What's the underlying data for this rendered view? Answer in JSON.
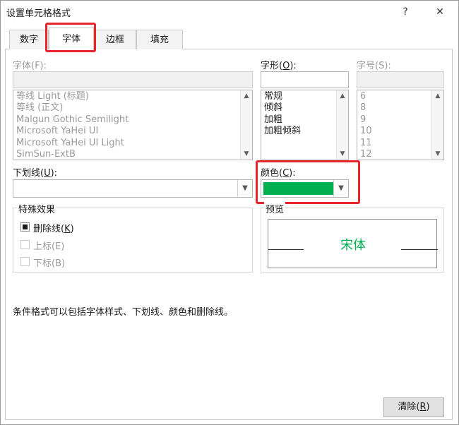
{
  "window": {
    "title": "设置单元格格式",
    "help": "?",
    "close": "✕"
  },
  "tabs": [
    {
      "label": "数字",
      "active": false
    },
    {
      "label": "字体",
      "active": true
    },
    {
      "label": "边框",
      "active": false
    },
    {
      "label": "填充",
      "active": false
    }
  ],
  "font": {
    "label": "字体(F):",
    "value": "",
    "options": [
      "等线 Light (标题)",
      "等线 (正文)",
      "Malgun Gothic Semilight",
      "Microsoft YaHei UI",
      "Microsoft YaHei UI Light",
      "SimSun-ExtB"
    ]
  },
  "style": {
    "label_pre": "字形(",
    "label_key": "O",
    "label_post": "):",
    "value": "",
    "options": [
      "常规",
      "倾斜",
      "加粗",
      "加粗倾斜"
    ]
  },
  "size": {
    "label": "字号(S):",
    "value": "",
    "options": [
      "6",
      "8",
      "9",
      "10",
      "11",
      "12"
    ]
  },
  "underline": {
    "label_pre": "下划线(",
    "label_key": "U",
    "label_post": "):",
    "value": ""
  },
  "color": {
    "label_pre": "颜色(",
    "label_key": "C",
    "label_post": "):",
    "swatch": "#00b050"
  },
  "effects": {
    "title": "特殊效果",
    "strike_pre": "删除线(",
    "strike_key": "K",
    "strike_post": ")",
    "strike_checked": true,
    "superscript": "上标(E)",
    "subscript": "下标(B)"
  },
  "preview": {
    "title": "预览",
    "sample": "宋体",
    "sample_color": "#00b050"
  },
  "note": "条件格式可以包括字体样式、下划线、颜色和删除线。",
  "clear_button": {
    "pre": "清除(",
    "key": "R",
    "post": ")"
  },
  "accent_highlight": "#e8252b"
}
